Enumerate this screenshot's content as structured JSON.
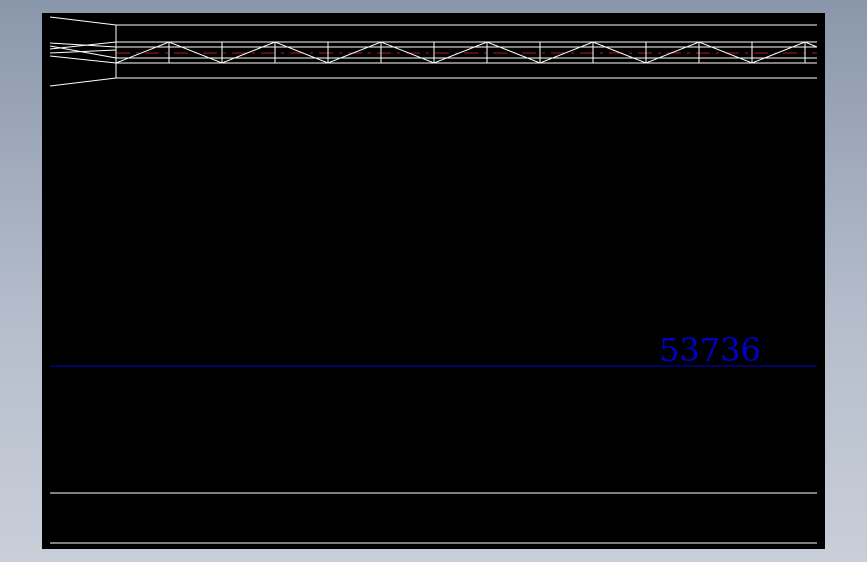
{
  "drawing": {
    "dimension_value": "53736",
    "colors": {
      "background": "#000000",
      "lines": "#ffffff",
      "dimension": "#0000cc",
      "centerline": "#b01818"
    }
  }
}
